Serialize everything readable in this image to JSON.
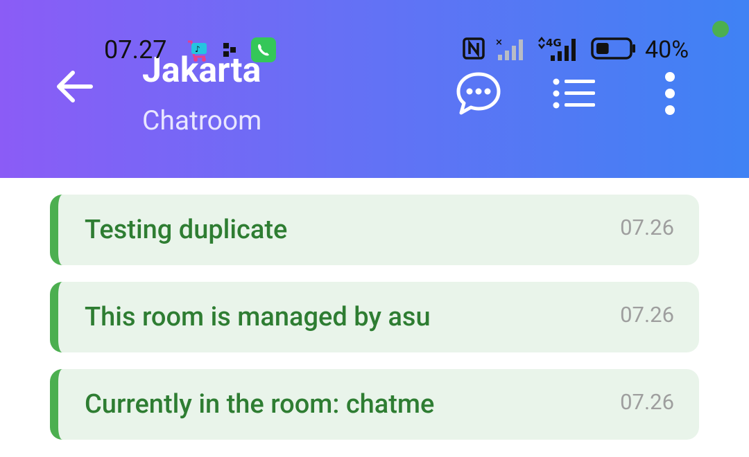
{
  "status_bar": {
    "time": "07.27",
    "battery_percent": "40%",
    "battery_level": 0.4,
    "network": "4G",
    "icons_left": [
      "tiktok-icon",
      "app-icon",
      "whatsapp-icon"
    ],
    "icons_right": [
      "nfc-icon",
      "signal-no-sim-icon",
      "signal-4g-icon",
      "battery-icon"
    ]
  },
  "app_bar": {
    "title": "Jakarta",
    "subtitle": "Chatroom",
    "actions": [
      "chat-icon",
      "list-icon",
      "more-vert-icon"
    ]
  },
  "messages": [
    {
      "text": "Testing duplicate",
      "time": "07.26"
    },
    {
      "text": "This room is managed by asu",
      "time": "07.26"
    },
    {
      "text": "Currently in the room: chatme",
      "time": "07.26"
    }
  ],
  "colors": {
    "header_start": "#8b5cf6",
    "header_end": "#3f82f4",
    "message_bg": "#e9f4ea",
    "message_accent": "#4caf50",
    "message_text": "#2e7d32"
  }
}
